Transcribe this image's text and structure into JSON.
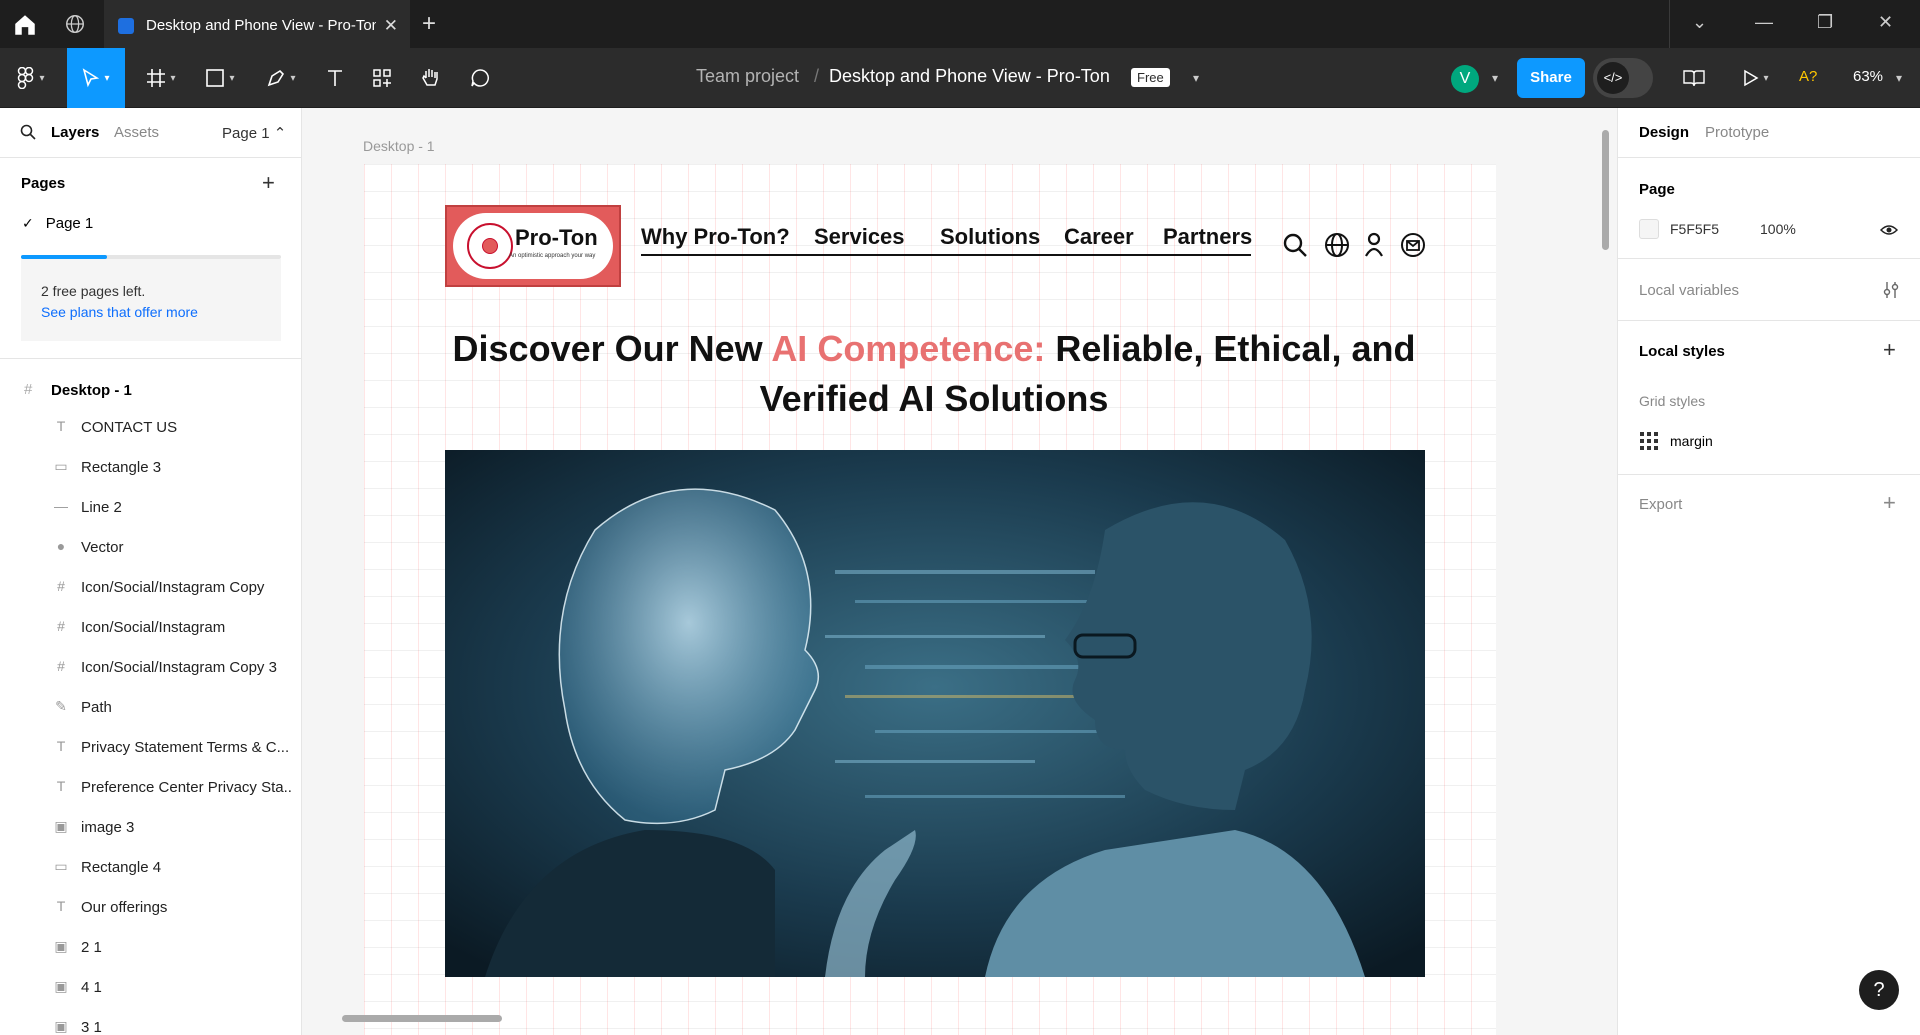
{
  "browser": {
    "tab_title": "Desktop and Phone View - Pro-Ton",
    "tab_close": "✕",
    "new_tab": "+"
  },
  "toolbar": {
    "team": "Team project",
    "separator": "/",
    "file_name": "Desktop and Phone View - Pro-Ton",
    "plan_badge": "Free",
    "avatar_initial": "V",
    "share_label": "Share",
    "dev_mode_label": "</>",
    "a11y_label": "A?",
    "zoom": "63%"
  },
  "left_panel": {
    "tabs": {
      "layers": "Layers",
      "assets": "Assets",
      "page_selector": "Page 1 ⌃"
    },
    "pages_title": "Pages",
    "pages_add": "+",
    "pages": [
      {
        "label": "Page 1",
        "selected": true
      }
    ],
    "plan": {
      "free_pages_fraction": 0.33,
      "line1": "2 free pages left.",
      "line2": "See plans that offer more"
    },
    "frame_layer": {
      "icon": "#",
      "label": "Desktop - 1"
    },
    "layers": [
      {
        "icon": "T",
        "label": "CONTACT US"
      },
      {
        "icon": "▭",
        "label": "Rectangle 3"
      },
      {
        "icon": "—",
        "label": "Line 2"
      },
      {
        "icon": "●",
        "label": "Vector"
      },
      {
        "icon": "#",
        "label": "Icon/Social/Instagram Copy"
      },
      {
        "icon": "#",
        "label": "Icon/Social/Instagram"
      },
      {
        "icon": "#",
        "label": "Icon/Social/Instagram Copy 3"
      },
      {
        "icon": "✎",
        "label": "Path"
      },
      {
        "icon": "T",
        "label": "Privacy Statement Terms & C..."
      },
      {
        "icon": "T",
        "label": "Preference Center Privacy Sta..."
      },
      {
        "icon": "▣",
        "label": "image 3"
      },
      {
        "icon": "▭",
        "label": "Rectangle 4"
      },
      {
        "icon": "T",
        "label": "Our offerings"
      },
      {
        "icon": "▣",
        "label": "2 1"
      },
      {
        "icon": "▣",
        "label": "4 1"
      },
      {
        "icon": "▣",
        "label": "3 1"
      }
    ]
  },
  "canvas": {
    "frame_label": "Desktop - 1",
    "site": {
      "brand": "Pro-Ton",
      "tagline": "An optimistic approach your way",
      "nav": [
        "Why Pro-Ton?",
        "Services",
        "Solutions",
        "Career",
        "Partners"
      ],
      "headline_pre": "Discover Our New ",
      "headline_accent": "AI Competence:",
      "headline_post": " Reliable, Ethical, and Verified AI Solutions",
      "accent_color": "#e87171"
    }
  },
  "right_panel": {
    "tabs": {
      "design": "Design",
      "prototype": "Prototype"
    },
    "page_title": "Page",
    "page_color": "F5F5F5",
    "page_opacity": "100%",
    "local_variables": "Local variables",
    "local_styles": "Local styles",
    "grid_styles": "Grid styles",
    "grid_style_name": "margin",
    "export": "Export",
    "plus": "+"
  },
  "help_label": "?",
  "colors": {
    "accent": "#0d99ff",
    "dark": "#2c2c2c"
  }
}
